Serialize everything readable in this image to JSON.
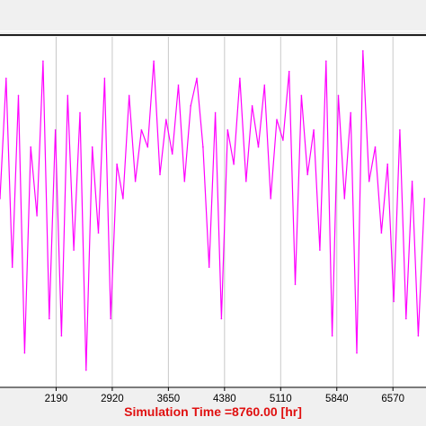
{
  "chart_data": {
    "type": "line",
    "x_ticks": [
      "2190",
      "2920",
      "3650",
      "4380",
      "5110",
      "5840",
      "6570"
    ],
    "xlim": [
      1460,
      7000
    ],
    "ylim": [
      0,
      1
    ],
    "grid": true,
    "series": [
      {
        "color": "#ff00ff",
        "x": [
          1460,
          1540,
          1620,
          1700,
          1780,
          1860,
          1940,
          2020,
          2100,
          2180,
          2260,
          2340,
          2420,
          2500,
          2580,
          2660,
          2740,
          2820,
          2900,
          2980,
          3060,
          3140,
          3220,
          3300,
          3380,
          3460,
          3540,
          3620,
          3700,
          3780,
          3860,
          3940,
          4020,
          4100,
          4180,
          4260,
          4340,
          4420,
          4500,
          4580,
          4660,
          4740,
          4820,
          4900,
          4980,
          5060,
          5140,
          5220,
          5300,
          5380,
          5460,
          5540,
          5620,
          5700,
          5780,
          5860,
          5940,
          6020,
          6100,
          6180,
          6260,
          6340,
          6420,
          6500,
          6580,
          6660,
          6740,
          6820,
          6900,
          6980
        ],
        "values": [
          0.55,
          0.9,
          0.35,
          0.85,
          0.1,
          0.7,
          0.5,
          0.95,
          0.2,
          0.75,
          0.15,
          0.85,
          0.4,
          0.8,
          0.05,
          0.7,
          0.45,
          0.9,
          0.2,
          0.65,
          0.55,
          0.85,
          0.6,
          0.75,
          0.7,
          0.95,
          0.62,
          0.78,
          0.68,
          0.88,
          0.6,
          0.82,
          0.9,
          0.7,
          0.35,
          0.8,
          0.2,
          0.75,
          0.65,
          0.9,
          0.6,
          0.82,
          0.7,
          0.88,
          0.55,
          0.78,
          0.72,
          0.92,
          0.3,
          0.85,
          0.62,
          0.75,
          0.4,
          0.95,
          0.15,
          0.85,
          0.55,
          0.8,
          0.1,
          0.98,
          0.6,
          0.7,
          0.45,
          0.65,
          0.25,
          0.75,
          0.2,
          0.6,
          0.15,
          0.55
        ]
      }
    ]
  },
  "footer": {
    "simulation_label": "Simulation Time =8760.00 [hr]"
  }
}
